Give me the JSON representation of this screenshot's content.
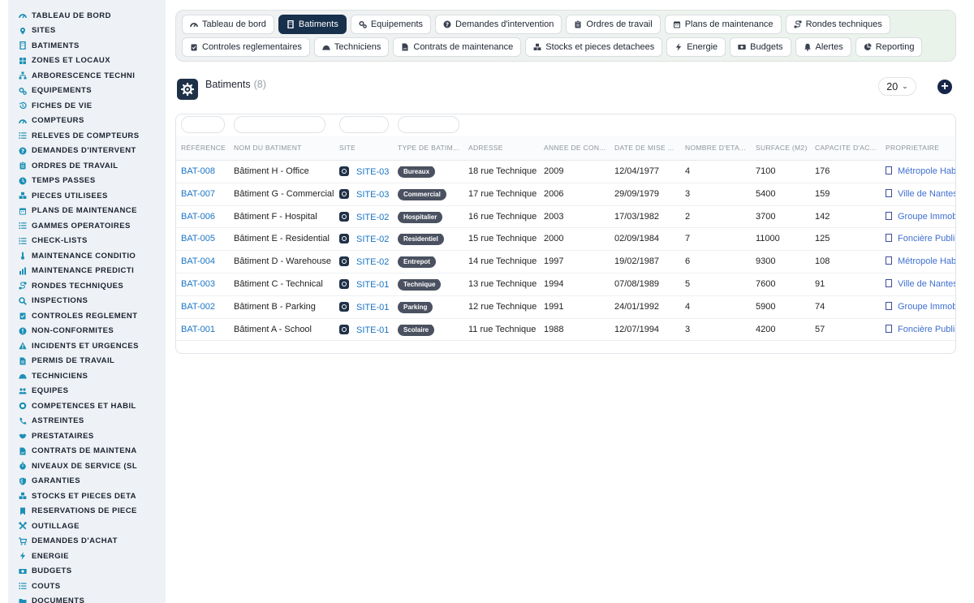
{
  "sidebar": {
    "items": [
      {
        "label": "TABLEAU DE BORD",
        "icon": "gauge-icon"
      },
      {
        "label": "SITES",
        "icon": "map-pin-icon"
      },
      {
        "label": "BATIMENTS",
        "icon": "building-icon"
      },
      {
        "label": "ZONES ET LOCAUX",
        "icon": "layers-icon"
      },
      {
        "label": "ARBORESCENCE TECHNI",
        "icon": "sitemap-icon"
      },
      {
        "label": "EQUIPEMENTS",
        "icon": "cogs-icon"
      },
      {
        "label": "FICHES DE VIE",
        "icon": "history-icon"
      },
      {
        "label": "COMPTEURS",
        "icon": "gauge-icon"
      },
      {
        "label": "RELEVES DE COMPTEURS",
        "icon": "list-icon"
      },
      {
        "label": "DEMANDES D'INTERVENT",
        "icon": "question-icon"
      },
      {
        "label": "ORDRES DE TRAVAIL",
        "icon": "clipboard-icon"
      },
      {
        "label": "TEMPS PASSES",
        "icon": "clock-icon"
      },
      {
        "label": "PIECES UTILISEES",
        "icon": "boxes-icon"
      },
      {
        "label": "PLANS DE MAINTENANCE",
        "icon": "calendar-icon"
      },
      {
        "label": "GAMMES OPERATOIRES",
        "icon": "list-icon"
      },
      {
        "label": "CHECK-LISTS",
        "icon": "list-icon"
      },
      {
        "label": "MAINTENANCE CONDITIO",
        "icon": "thermometer-icon"
      },
      {
        "label": "MAINTENANCE PREDICTI",
        "icon": "chart-icon"
      },
      {
        "label": "RONDES TECHNIQUES",
        "icon": "route-icon"
      },
      {
        "label": "INSPECTIONS",
        "icon": "search-icon"
      },
      {
        "label": "CONTROLES REGLEMENT",
        "icon": "clipboard-check-icon"
      },
      {
        "label": "NON-CONFORMITES",
        "icon": "alert-circle-icon"
      },
      {
        "label": "INCIDENTS ET URGENCES",
        "icon": "warning-icon"
      },
      {
        "label": "PERMIS DE TRAVAIL",
        "icon": "file-icon"
      },
      {
        "label": "TECHNICIENS",
        "icon": "helmet-icon"
      },
      {
        "label": "EQUIPES",
        "icon": "users-icon"
      },
      {
        "label": "COMPETENCES ET HABIL",
        "icon": "certificate-icon"
      },
      {
        "label": "ASTREINTES",
        "icon": "phone-icon"
      },
      {
        "label": "PRESTATAIRES",
        "icon": "handshake-icon"
      },
      {
        "label": "CONTRATS DE MAINTENA",
        "icon": "file-contract-icon"
      },
      {
        "label": "NIVEAUX DE SERVICE (SL",
        "icon": "stopwatch-icon"
      },
      {
        "label": "GARANTIES",
        "icon": "shield-icon"
      },
      {
        "label": "STOCKS ET PIECES DETA",
        "icon": "boxes-icon"
      },
      {
        "label": "RESERVATIONS DE PIECE",
        "icon": "bookmark-icon"
      },
      {
        "label": "OUTILLAGE",
        "icon": "tools-icon"
      },
      {
        "label": "DEMANDES D'ACHAT",
        "icon": "cart-icon"
      },
      {
        "label": "ENERGIE",
        "icon": "bolt-icon"
      },
      {
        "label": "BUDGETS",
        "icon": "money-icon"
      },
      {
        "label": "COUTS",
        "icon": "list-icon"
      },
      {
        "label": "DOCUMENTS",
        "icon": "folder-icon"
      }
    ]
  },
  "topnav": {
    "row1": [
      {
        "label": "Tableau de bord",
        "icon": "gauge-icon",
        "active": false
      },
      {
        "label": "Batiments",
        "icon": "building-icon",
        "active": true
      },
      {
        "label": "Equipements",
        "icon": "cogs-icon",
        "active": false
      },
      {
        "label": "Demandes d'intervention",
        "icon": "question-icon",
        "active": false
      },
      {
        "label": "Ordres de travail",
        "icon": "clipboard-icon",
        "active": false
      },
      {
        "label": "Plans de maintenance",
        "icon": "calendar-icon",
        "active": false
      },
      {
        "label": "Rondes techniques",
        "icon": "route-icon",
        "active": false
      }
    ],
    "row2": [
      {
        "label": "Controles reglementaires",
        "icon": "clipboard-check-icon",
        "active": false
      },
      {
        "label": "Techniciens",
        "icon": "helmet-icon",
        "active": false
      },
      {
        "label": "Contrats de maintenance",
        "icon": "file-contract-icon",
        "active": false
      },
      {
        "label": "Stocks et pieces detachees",
        "icon": "boxes-icon",
        "active": false
      },
      {
        "label": "Energie",
        "icon": "bolt-icon",
        "active": false
      },
      {
        "label": "Budgets",
        "icon": "money-icon",
        "active": false
      },
      {
        "label": "Alertes",
        "icon": "bell-icon",
        "active": false
      },
      {
        "label": "Reporting",
        "icon": "pie-icon",
        "active": false
      }
    ]
  },
  "page": {
    "title": "Batiments",
    "count": "(8)",
    "per_page": "20"
  },
  "table": {
    "columns": [
      "RÉFÉRENCE",
      "NOM DU BATIMENT",
      "SITE",
      "TYPE DE BATIM...",
      "ADRESSE",
      "ANNEE DE CON...",
      "DATE DE MISE ...",
      "NOMBRE D'ETA...",
      "SURFACE (M2)",
      "CAPACITE D'AC...",
      "PROPRIETAIRE"
    ],
    "rows": [
      {
        "ref": "BAT-008",
        "name": "Bâtiment H - Office",
        "site": "SITE-03",
        "type": "Bureaux",
        "address": "18 rue Technique",
        "year": "2009",
        "date": "12/04/1977",
        "floors": "4",
        "surface": "7100",
        "capacity": "176",
        "owner": "Métropole Habi"
      },
      {
        "ref": "BAT-007",
        "name": "Bâtiment G - Commercial",
        "site": "SITE-03",
        "type": "Commercial",
        "address": "17 rue Technique",
        "year": "2006",
        "date": "29/09/1979",
        "floors": "3",
        "surface": "5400",
        "capacity": "159",
        "owner": "Ville de Nantes"
      },
      {
        "ref": "BAT-006",
        "name": "Bâtiment F - Hospital",
        "site": "SITE-02",
        "type": "Hospitalier",
        "address": "16 rue Technique",
        "year": "2003",
        "date": "17/03/1982",
        "floors": "2",
        "surface": "3700",
        "capacity": "142",
        "owner": "Groupe Immob"
      },
      {
        "ref": "BAT-005",
        "name": "Bâtiment E - Residential",
        "site": "SITE-02",
        "type": "Residentiel",
        "address": "15 rue Technique",
        "year": "2000",
        "date": "02/09/1984",
        "floors": "7",
        "surface": "11000",
        "capacity": "125",
        "owner": "Foncière Public"
      },
      {
        "ref": "BAT-004",
        "name": "Bâtiment D - Warehouse",
        "site": "SITE-02",
        "type": "Entrepot",
        "address": "14 rue Technique",
        "year": "1997",
        "date": "19/02/1987",
        "floors": "6",
        "surface": "9300",
        "capacity": "108",
        "owner": "Métropole Habi"
      },
      {
        "ref": "BAT-003",
        "name": "Bâtiment C - Technical",
        "site": "SITE-01",
        "type": "Technique",
        "address": "13 rue Technique",
        "year": "1994",
        "date": "07/08/1989",
        "floors": "5",
        "surface": "7600",
        "capacity": "91",
        "owner": "Ville de Nantes"
      },
      {
        "ref": "BAT-002",
        "name": "Bâtiment B - Parking",
        "site": "SITE-01",
        "type": "Parking",
        "address": "12 rue Technique",
        "year": "1991",
        "date": "24/01/1992",
        "floors": "4",
        "surface": "5900",
        "capacity": "74",
        "owner": "Groupe Immob"
      },
      {
        "ref": "BAT-001",
        "name": "Bâtiment A - School",
        "site": "SITE-01",
        "type": "Scolaire",
        "address": "11 rue Technique",
        "year": "1988",
        "date": "12/07/1994",
        "floors": "3",
        "surface": "4200",
        "capacity": "57",
        "owner": "Foncière Public"
      }
    ]
  }
}
